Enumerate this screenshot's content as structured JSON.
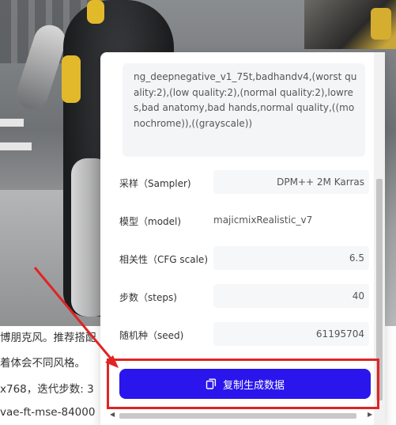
{
  "prompt_text": "ng_deepnegative_v1_75t,badhandv4,(worst quality:2),(low quality:2),(normal quality:2),lowres,bad anatomy,bad hands,normal quality,((monochrome)),((grayscale))",
  "params": [
    {
      "label": "采样（Sampler)",
      "value": "DPM++ 2M Karras"
    },
    {
      "label": "模型（model)",
      "value": "majicmixRealistic_v7"
    },
    {
      "label": "相关性（CFG scale)",
      "value": "6.5"
    },
    {
      "label": "步数（steps)",
      "value": "40"
    },
    {
      "label": "随机种（seed)",
      "value": "61195704"
    }
  ],
  "copy_button_label": "复制生成数据",
  "description_lines": [
    "博朋克风。推荐搭配",
    "着体会不同风格。",
    "x768，迭代步数: 3",
    "vae-ft-mse-84000"
  ],
  "colors": {
    "primary_button": "#2a16ec",
    "annotation_red": "#e02424"
  },
  "icons": {
    "copy": "copy-icon",
    "scroll_left": "chevron-left-icon",
    "scroll_right": "chevron-right-icon"
  }
}
